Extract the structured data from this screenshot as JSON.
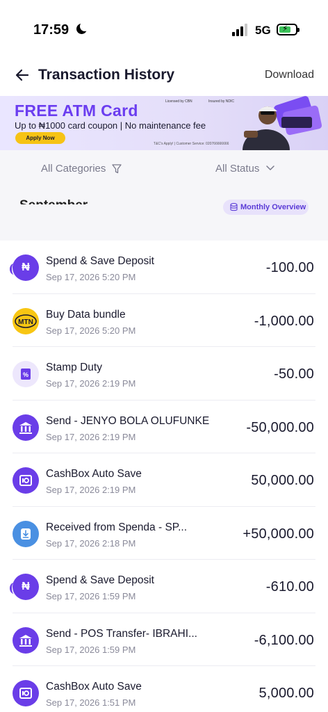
{
  "status_bar": {
    "time": "17:59",
    "network": "5G"
  },
  "header": {
    "title": "Transaction History",
    "download_label": "Download"
  },
  "banner": {
    "title": "FREE ATM Card",
    "subtitle": "Up to ₦1000 card coupon  |  No maintenance fee",
    "apply_label": "Apply Now",
    "licensed": "Licensed by CBN",
    "insured": "Insured by NDIC",
    "terms": "T&C's Apply! | Customer Service: 020766666666"
  },
  "filters": {
    "categories_label": "All Categories",
    "status_label": "All Status"
  },
  "month": {
    "label": "September",
    "overview_label": "Monthly Overview"
  },
  "transactions": [
    {
      "title": "Spend & Save Deposit",
      "date": "Sep 17, 2026 5:20 PM",
      "amount": "-100.00",
      "icon": "naira-icon"
    },
    {
      "title": "Buy Data bundle",
      "date": "Sep 17, 2026 5:20 PM",
      "amount": "-1,000.00",
      "icon": "mtn-logo"
    },
    {
      "title": "Stamp Duty",
      "date": "Sep 17, 2026 2:19 PM",
      "amount": "-50.00",
      "icon": "receipt-icon"
    },
    {
      "title": "Send - JENYO BOLA OLUFUNKE",
      "date": "Sep 17, 2026 2:19 PM",
      "amount": "-50,000.00",
      "icon": "bank-icon"
    },
    {
      "title": "CashBox Auto Save",
      "date": "Sep 17, 2026 2:19 PM",
      "amount": "50,000.00",
      "icon": "safe-icon"
    },
    {
      "title": "Received from Spenda - SP...",
      "date": "Sep 17, 2026 2:18 PM",
      "amount": "+50,000.00",
      "icon": "download-icon"
    },
    {
      "title": "Spend & Save Deposit",
      "date": "Sep 17, 2026 1:59 PM",
      "amount": "-610.00",
      "icon": "naira-icon"
    },
    {
      "title": "Send - POS Transfer- IBRAHI...",
      "date": "Sep 17, 2026 1:59 PM",
      "amount": "-6,100.00",
      "icon": "bank-icon"
    },
    {
      "title": "CashBox Auto Save",
      "date": "Sep 17, 2026 1:51 PM",
      "amount": "5,000.00",
      "icon": "safe-icon"
    }
  ],
  "colors": {
    "brand": "#6a3de8",
    "banner_title": "#6b3df0",
    "apply_button": "#f6c315",
    "mtn_yellow": "#f8c613"
  }
}
